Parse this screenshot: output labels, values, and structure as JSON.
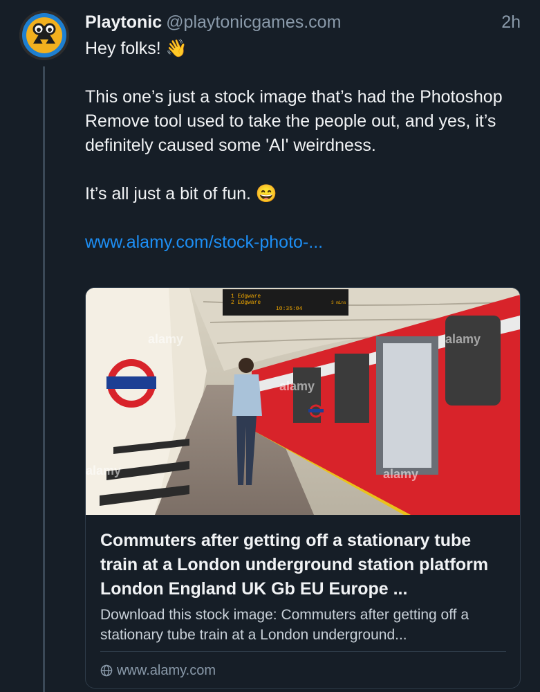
{
  "post": {
    "author_name": "Playtonic",
    "author_handle": "@playtonicgames.com",
    "timestamp": "2h",
    "greeting": "Hey folks! 👋",
    "body_1": "This one’s just a stock image that’s had the Photoshop Remove tool used to take the people out, and yes, it’s definitely caused some 'AI' weirdness.",
    "body_2": "It’s all just a bit of fun. 😄",
    "link_text": "www.alamy.com/stock-photo-..."
  },
  "card": {
    "title": "Commuters after getting off a stationary tube train at a London underground station platform London England UK Gb EU Europe ...",
    "description": "Download this stock image: Commuters after getting off a stationary tube train at a London underground...",
    "domain": "www.alamy.com",
    "domain_icon": "globe-icon",
    "image": {
      "board_line_1": "1 Edgware",
      "board_line_2": "2 Edgware",
      "board_time": "10:35:04",
      "board_mins": "3 mins",
      "watermark": "alamy"
    }
  },
  "colors": {
    "background": "#161e27",
    "link": "#1d8ff5",
    "muted": "#8a9aaa",
    "tube_red": "#d8232a"
  }
}
